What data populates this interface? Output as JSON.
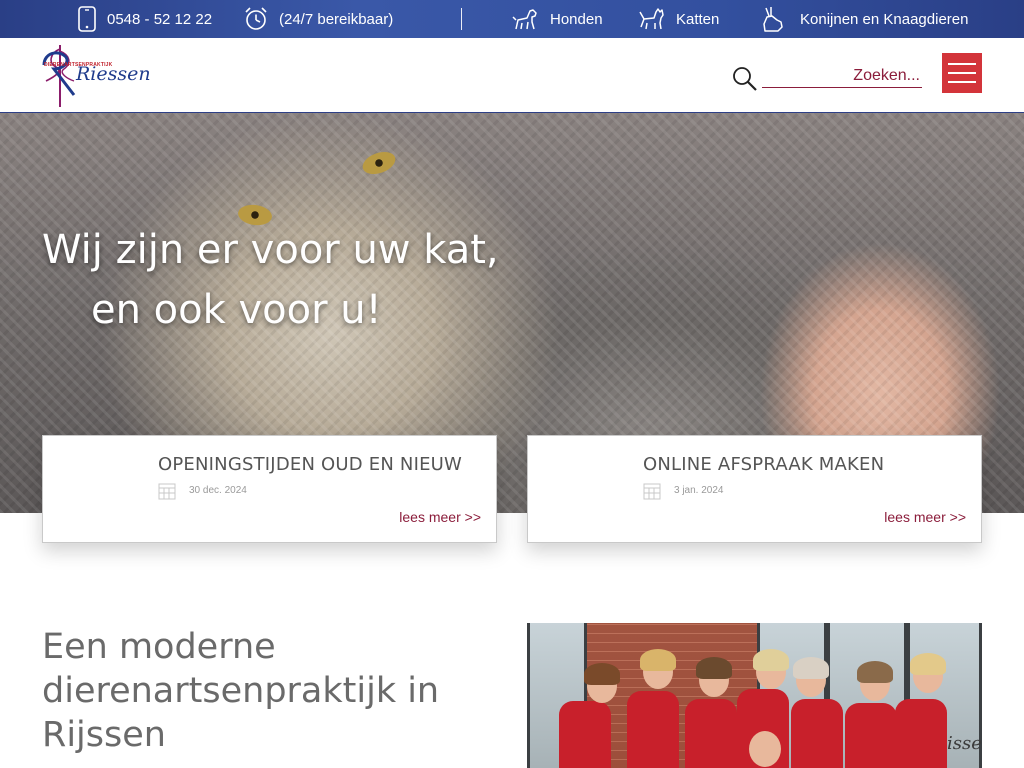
{
  "topbar": {
    "phone": "0548 - 52 12 22",
    "availability": "(24/7 bereikbaar)",
    "nav": [
      {
        "label": "Honden",
        "icon": "dog-icon"
      },
      {
        "label": "Katten",
        "icon": "cat-icon"
      },
      {
        "label": "Konijnen en Knaagdieren",
        "icon": "rabbit-icon"
      }
    ]
  },
  "header": {
    "logo_text": "Riessen",
    "logo_small": "DIERENARTSENPRAKTIJK",
    "search_placeholder": "Zoeken..."
  },
  "hero": {
    "line1": "Wij zijn er voor uw kat,",
    "line2": "en ook voor u!"
  },
  "cards": [
    {
      "title": "OPENINGSTIJDEN OUD EN NIEUW",
      "date": "30 dec. 2024",
      "more": "lees meer >>"
    },
    {
      "title": "ONLINE AFSPRAAK MAKEN",
      "date": "3 jan. 2024",
      "more": "lees meer >>"
    }
  ],
  "intro": {
    "title": "Een moderne dierenartsenpraktijk in Rijssen"
  },
  "team_photo": {
    "sign_text": "issen"
  },
  "colors": {
    "topbar": "#33509f",
    "accent": "#8b1d3b",
    "menu_button": "#d3343a",
    "uniform": "#c8202b"
  }
}
